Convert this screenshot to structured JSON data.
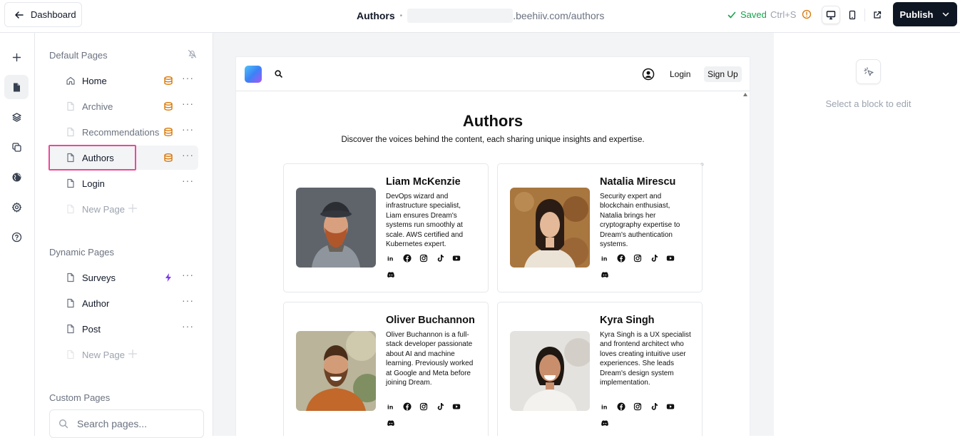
{
  "topbar": {
    "back_label": "Dashboard",
    "page_title": "Authors",
    "url_domain": ".beehiiv.com/authors",
    "saved_label": "Saved",
    "shortcut": "Ctrl+S",
    "publish_label": "Publish"
  },
  "sidebar": {
    "default_title": "Default Pages",
    "default_pages": [
      {
        "label": "Home"
      },
      {
        "label": "Archive"
      },
      {
        "label": "Recommendations"
      },
      {
        "label": "Authors"
      },
      {
        "label": "Login"
      },
      {
        "label": "New Page"
      }
    ],
    "dynamic_title": "Dynamic Pages",
    "dynamic_pages": [
      {
        "label": "Surveys"
      },
      {
        "label": "Author"
      },
      {
        "label": "Post"
      },
      {
        "label": "New Page"
      }
    ],
    "custom_title": "Custom Pages",
    "search_placeholder": "Search pages..."
  },
  "site": {
    "login": "Login",
    "signup": "Sign Up",
    "title": "Authors",
    "subtitle": "Discover the voices behind the content, each sharing unique insights and expertise.",
    "authors": [
      {
        "name": "Liam McKenzie",
        "bio": "DevOps wizard and infrastructure specialist, Liam ensures Dream's systems run smoothly at scale. AWS certified and Kubernetes expert."
      },
      {
        "name": "Natalia Mirescu",
        "bio": "Security expert and blockchain enthusiast, Natalia brings her cryptography expertise to Dream's authentication systems."
      },
      {
        "name": "Oliver Buchannon",
        "bio": "Oliver Buchannon is a full-stack developer passionate about AI and machine learning. Previously worked at Google and Meta before joining Dream."
      },
      {
        "name": "Kyra Singh",
        "bio": "Kyra Singh is a UX specialist and frontend architect who loves creating intuitive user experiences. She leads Dream's design system implementation."
      }
    ]
  },
  "right_panel": {
    "hint": "Select a block to edit"
  },
  "colors": {
    "accent_green": "#16a34a",
    "publish_bg": "#0f1623",
    "highlight_pink": "#ec4899",
    "badge_orange": "#d97706",
    "bolt_purple": "#7c3aed"
  }
}
